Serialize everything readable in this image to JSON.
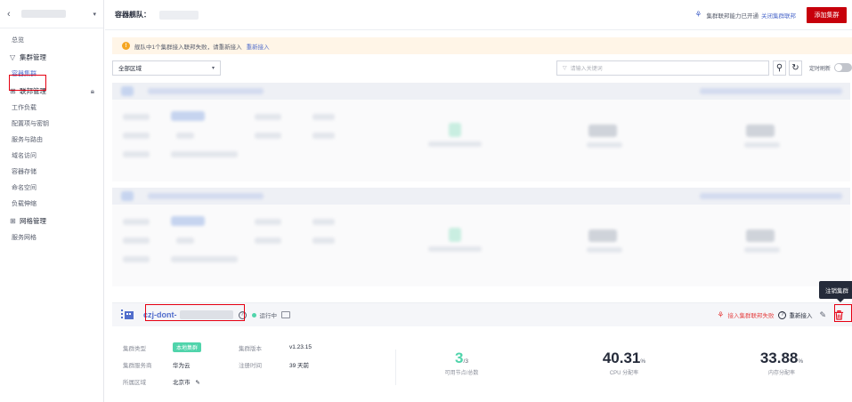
{
  "sidebar": {
    "back_icon": "chevron-left-icon",
    "items": [
      {
        "label": "总览",
        "type": "item"
      },
      {
        "label": "集群管理",
        "type": "group",
        "icon": "filter-icon"
      },
      {
        "label": "容器集群",
        "type": "item",
        "active": true
      },
      {
        "label": "联邦管理",
        "type": "group",
        "icon": "grid-icon",
        "lock": true
      },
      {
        "label": "工作负载",
        "type": "item"
      },
      {
        "label": "配置项与密钥",
        "type": "item"
      },
      {
        "label": "服务与路由",
        "type": "item"
      },
      {
        "label": "域名访问",
        "type": "item"
      },
      {
        "label": "容器存储",
        "type": "item"
      },
      {
        "label": "命名空间",
        "type": "item"
      },
      {
        "label": "负载伸缩",
        "type": "item"
      },
      {
        "label": "网格管理",
        "type": "group",
        "icon": "grid-icon"
      },
      {
        "label": "服务网格",
        "type": "item"
      }
    ]
  },
  "topbar": {
    "title": "容器舰队：",
    "fed_status": "集群联邦能力已开通",
    "fed_close_link": "关闭集群联邦",
    "add_button": "添加集群",
    "brand_color": "#c7000b"
  },
  "alert": {
    "text": "舰队中1个集群接入联邦失败，请重新接入",
    "link": "重新接入"
  },
  "filter": {
    "region": "全部区域",
    "search_placeholder": "请输入关键词",
    "auto_refresh": "定时刷新"
  },
  "cluster": {
    "name": "czj-dont-",
    "status": "运行中",
    "join_failed": "接入集群联邦失败",
    "rejoin": "重新接入",
    "type_label": "集群类型",
    "type_value": "本地集群",
    "provider_label": "集群服务商",
    "provider_value": "华为云",
    "region_label": "所属区域",
    "region_value": "北京市",
    "version_label": "集群版本",
    "version_value": "v1.23.15",
    "regtime_label": "注册时间",
    "regtime_value": "39 天前",
    "nodes_available": "3",
    "nodes_total": "/3",
    "nodes_label": "可用节点/总数",
    "cpu_value": "40.31",
    "cpu_unit": "%",
    "cpu_label": "CPU 分配率",
    "mem_value": "33.88",
    "mem_unit": "%",
    "mem_label": "内存分配率"
  },
  "tooltip": {
    "text": "注销集群"
  }
}
